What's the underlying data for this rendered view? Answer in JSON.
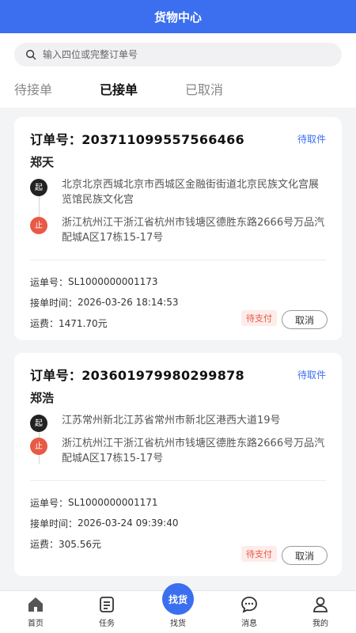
{
  "header": {
    "title": "货物中心"
  },
  "search": {
    "placeholder": "输入四位或完整订单号"
  },
  "tabs": [
    {
      "label": "待接单"
    },
    {
      "label": "已接单"
    },
    {
      "label": "已取消"
    }
  ],
  "orders": [
    {
      "order_label": "订单号：",
      "order_no": "203711099557566466",
      "status": "待取件",
      "name": "郑天",
      "start_mark": "起",
      "end_mark": "止",
      "from": "北京北京西城北京市西城区金融街街道北京民族文化宫展览馆民族文化宫",
      "to": "浙江杭州江干浙江省杭州市钱塘区德胜东路2666号万品汽配城A区17栋15-17号",
      "waybill_label": "运单号：",
      "waybill": "SL1000000001173",
      "time_label": "接单时间：",
      "time": "2026-03-26 18:14:53",
      "fee_label": "运费：",
      "fee": "1471.70元",
      "pay_status": "待支付",
      "cancel_label": "取消"
    },
    {
      "order_label": "订单号：",
      "order_no": "203601979980299878",
      "order_no_display": "203601979980299878",
      "status": "待取件",
      "name": "郑浩",
      "start_mark": "起",
      "end_mark": "止",
      "from": "江苏常州新北江苏省常州市新北区港西大道19号",
      "to": "浙江杭州江干浙江省杭州市钱塘区德胜东路2666号万品汽配城A区17栋15-17号",
      "waybill_label": "运单号：",
      "waybill": "SL1000000001171",
      "time_label": "接单时间：",
      "time": "2026-03-24 09:39:40",
      "fee_label": "运费：",
      "fee": "305.56元",
      "pay_status": "待支付",
      "cancel_label": "取消"
    }
  ],
  "bottom_nav": [
    {
      "label": "首页",
      "icon": "home-icon"
    },
    {
      "label": "任务",
      "icon": "task-icon"
    },
    {
      "label": "找货",
      "bubble": "找货",
      "icon": "find-goods"
    },
    {
      "label": "消息",
      "icon": "message-icon"
    },
    {
      "label": "我的",
      "icon": "user-icon"
    }
  ],
  "colors": {
    "primary": "#3b6ff0",
    "danger": "#e85a45"
  }
}
